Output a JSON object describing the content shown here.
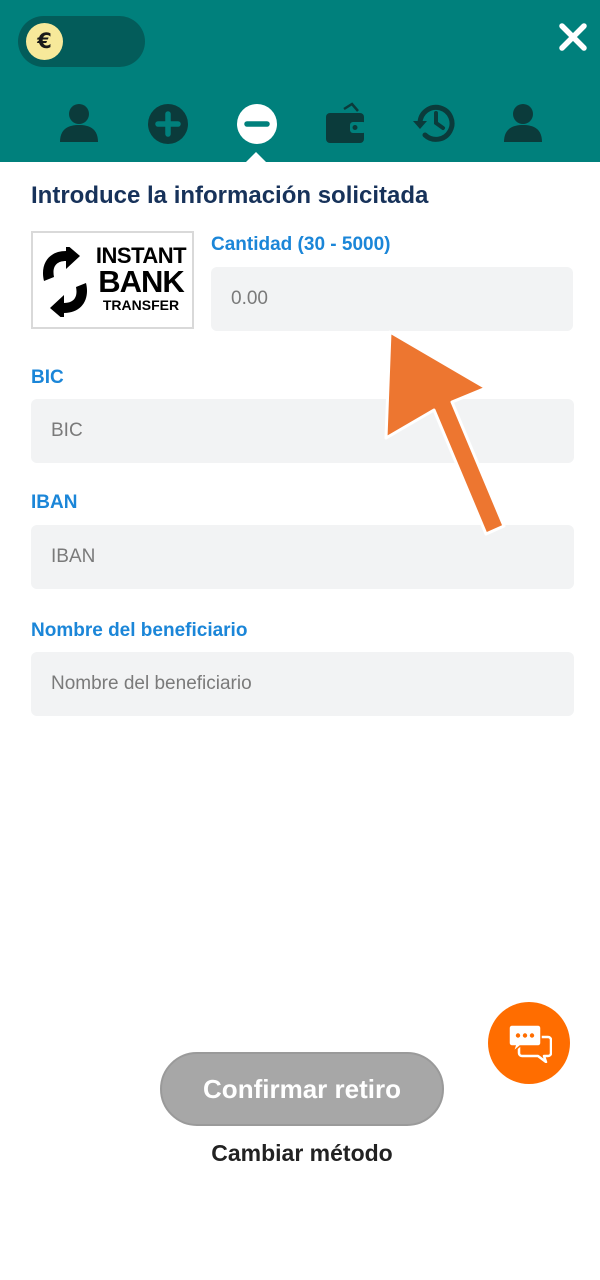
{
  "header": {
    "currency_symbol": "€",
    "close_label": "×",
    "nav_icons": [
      "profile-icon",
      "deposit-plus-icon",
      "withdraw-minus-icon",
      "wallet-icon",
      "history-icon",
      "account-icon",
      "more-chevron-icon"
    ],
    "active_icon": "withdraw-minus-icon"
  },
  "form": {
    "title": "Introduce la información solicitada",
    "logo": {
      "line1": "INSTANT",
      "line2": "BANK",
      "line3": "TRANSFER"
    },
    "amount": {
      "label": "Cantidad (30 - 5000)",
      "placeholder": "0.00"
    },
    "bic": {
      "label": "BIC",
      "placeholder": "BIC"
    },
    "iban": {
      "label": "IBAN",
      "placeholder": "IBAN"
    },
    "beneficiary": {
      "label": "Nombre del beneficiario",
      "placeholder": "Nombre del beneficiario"
    }
  },
  "actions": {
    "confirm_label": "Confirmar retiro",
    "change_method_label": "Cambiar método",
    "chat_icon": "chat-bubbles-icon"
  },
  "colors": {
    "header_bg": "#00807c",
    "title": "#17325a",
    "label": "#1b86d8",
    "annotation_arrow": "#ed7630",
    "chat_button": "#ff6d00",
    "confirm_disabled": "#a7a7a7"
  }
}
